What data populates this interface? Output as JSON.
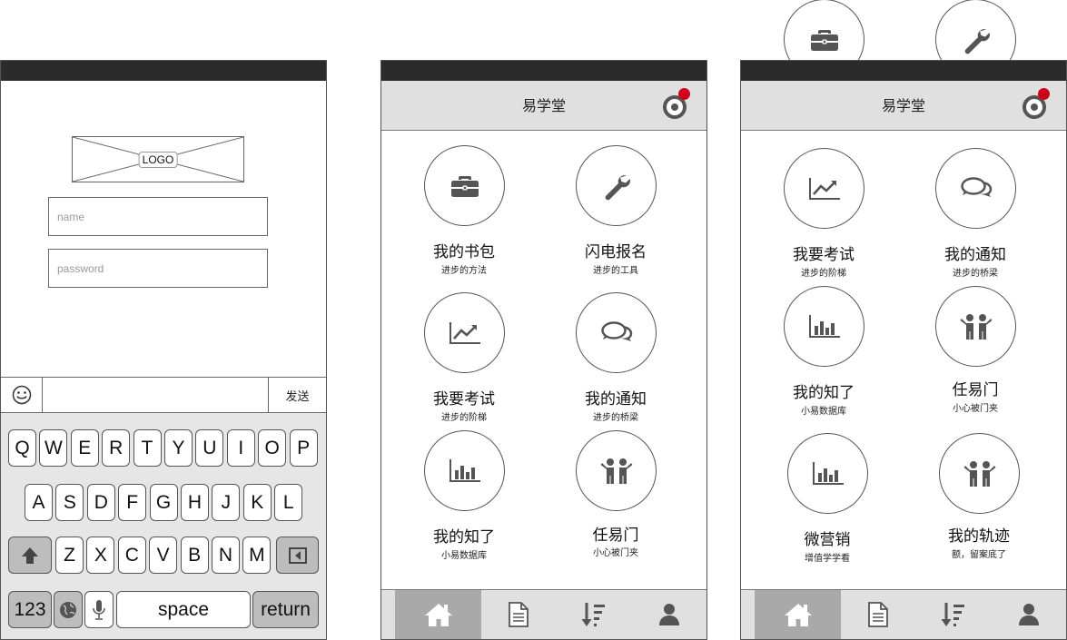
{
  "login": {
    "logo_text": "LOGO",
    "name_placeholder": "name",
    "password_placeholder": "password",
    "send_label": "发送",
    "emoji_icon": "smiley-icon",
    "keyboard": {
      "row1": [
        "Q",
        "W",
        "E",
        "R",
        "T",
        "Y",
        "U",
        "I",
        "O",
        "P"
      ],
      "row2": [
        "A",
        "S",
        "D",
        "F",
        "G",
        "H",
        "J",
        "K",
        "L"
      ],
      "row3": [
        "Z",
        "X",
        "C",
        "V",
        "B",
        "N",
        "M"
      ],
      "numbers_label": "123",
      "space_label": "space",
      "return_label": "return"
    }
  },
  "app": {
    "title": "易学堂",
    "notification_color": "#d0021b",
    "accent_dark": "#555555",
    "tabs": [
      {
        "icon": "home-icon",
        "active": true
      },
      {
        "icon": "document-icon",
        "active": false
      },
      {
        "icon": "sort-icon",
        "active": false
      },
      {
        "icon": "user-icon",
        "active": false
      }
    ]
  },
  "screen2": {
    "tiles": [
      {
        "title": "我的书包",
        "subtitle": "进步的方法",
        "icon": "briefcase-icon"
      },
      {
        "title": "闪电报名",
        "subtitle": "进步的工具",
        "icon": "wrench-icon"
      },
      {
        "title": "我要考试",
        "subtitle": "进步的阶梯",
        "icon": "line-chart-icon"
      },
      {
        "title": "我的通知",
        "subtitle": "进步的桥梁",
        "icon": "chat-icon"
      },
      {
        "title": "我的知了",
        "subtitle": "小易数据库",
        "icon": "bar-chart-icon"
      },
      {
        "title": "任易门",
        "subtitle": "小心被门夹",
        "icon": "people-icon"
      }
    ]
  },
  "screen3": {
    "overflow_icons": [
      "briefcase-icon",
      "wrench-icon"
    ],
    "tiles": [
      {
        "title": "我要考试",
        "subtitle": "进步的阶梯",
        "icon": "line-chart-icon"
      },
      {
        "title": "我的通知",
        "subtitle": "进步的桥梁",
        "icon": "chat-icon"
      },
      {
        "title": "我的知了",
        "subtitle": "小易数据库",
        "icon": "bar-chart-icon"
      },
      {
        "title": "任易门",
        "subtitle": "小心被门夹",
        "icon": "people-icon"
      },
      {
        "title": "微营销",
        "subtitle": "增值学学看",
        "icon": "bar-chart-icon"
      },
      {
        "title": "我的轨迹",
        "subtitle": "额，留案底了",
        "icon": "people-icon"
      }
    ]
  }
}
